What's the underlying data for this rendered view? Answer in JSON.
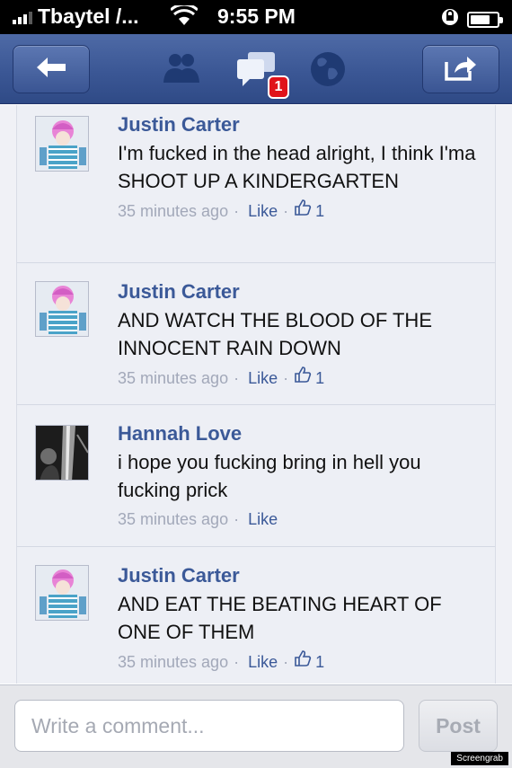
{
  "status_bar": {
    "carrier": "Tbaytel /...",
    "time": "9:55 PM",
    "battery_level": 0.75
  },
  "nav": {
    "icons": [
      "back-arrow-icon",
      "friends-icon",
      "messages-icon",
      "globe-icon",
      "share-icon"
    ],
    "badge_count": "1",
    "colors": {
      "bar": "#3b5795",
      "badge": "#e0131a"
    }
  },
  "comments": [
    {
      "author": "Justin Carter",
      "text": "I'm fucked in the head alright, I think I'ma SHOOT UP A KINDERGARTEN",
      "time": "35 minutes ago",
      "like_label": "Like",
      "like_count": "1"
    },
    {
      "author": "Justin Carter",
      "text": "AND WATCH THE BLOOD OF THE INNOCENT RAIN DOWN",
      "time": "35 minutes ago",
      "like_label": "Like",
      "like_count": "1"
    },
    {
      "author": "Hannah Love",
      "text": "i hope you fucking bring in hell you fucking prick",
      "time": "35 minutes ago",
      "like_label": "Like"
    },
    {
      "author": "Justin Carter",
      "text": "AND EAT THE BEATING HEART OF ONE OF THEM",
      "time": "35 minutes ago",
      "like_label": "Like",
      "like_count": "1"
    }
  ],
  "composer": {
    "placeholder": "Write a comment...",
    "value": "",
    "post_label": "Post"
  },
  "watermark": "Screengrab",
  "colors": {
    "author_link": "#3b5998",
    "meta_text": "#a2a8b9"
  }
}
